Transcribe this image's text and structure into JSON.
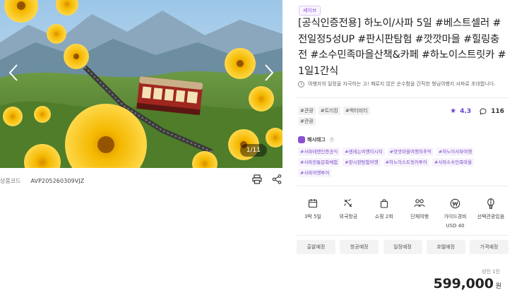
{
  "gallery": {
    "counter": "1/11"
  },
  "product_code": {
    "label": "상품코드",
    "value": "AVP205260309VJZ"
  },
  "badge": "세이브",
  "title": "[공식인증전용] 하노이/사파 5일 #베스트셀러 #전일정5성UP #판시판탐험 #깟깟마을 #힐링충전 #소수민족마을산책&카페 #하노이스트릿카 #1일1간식",
  "notice": "여행자의 일정을 자극하는 고! 패로지 않은 순수함을 간직한 형님여행지 사파로 초대합니다.",
  "category_tags": [
    "#관광",
    "#트리킹",
    "#액티비티",
    "#관광"
  ],
  "stats": {
    "rating": "4.3",
    "reviews": "116"
  },
  "hashtag_section": {
    "title": "해시태그",
    "help": "?"
  },
  "hashtags": [
    "#사파테앤인증공식",
    "#센레는여행이시작",
    "#깟깟마을여행의추억",
    "#하노이사파여행",
    "#사파전통문화체험",
    "#판시판탐험여행",
    "#하노이스트릿카투어",
    "#사파소수민족마을",
    "#사파여행투어"
  ],
  "features": [
    {
      "icon": "calendar-icon",
      "label": "3박 5일"
    },
    {
      "icon": "airplane-icon",
      "label": "외국항공"
    },
    {
      "icon": "shopping-bag-icon",
      "label": "쇼핑 2회"
    },
    {
      "icon": "group-icon",
      "label": "단체여행"
    },
    {
      "icon": "won-coin-icon",
      "label": "가이드경비",
      "sub": "USD 40"
    },
    {
      "icon": "balloon-icon",
      "label": "선택관광있음"
    }
  ],
  "tabs": [
    "출발예정",
    "항공예정",
    "일정예정",
    "호텔예정",
    "가격예정"
  ],
  "price": {
    "label": "성인 1인",
    "amount": "599,000",
    "unit": "원"
  },
  "colors": {
    "accent": "#8a4fd1",
    "star": "#6b3fd0"
  }
}
